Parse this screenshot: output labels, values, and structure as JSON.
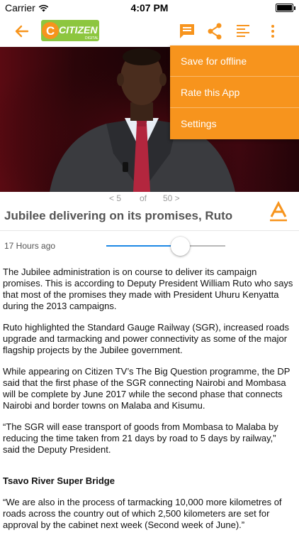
{
  "status_bar": {
    "carrier": "Carrier",
    "time": "4:07 PM",
    "battery_level": 1.0
  },
  "toolbar": {
    "logo_text": "CITIZEN",
    "logo_sub": "DIGITAL",
    "icons": [
      "back-arrow-icon",
      "comment-icon",
      "share-icon",
      "text-lines-icon",
      "more-vertical-icon"
    ]
  },
  "menu": {
    "items": [
      "Save for offline",
      "Rate this App",
      "Settings"
    ]
  },
  "pager": {
    "prev": "< 5",
    "of": "of",
    "next": "50 >"
  },
  "article": {
    "headline": "Jubilee delivering on its promises, Ruto",
    "time_ago": "17 Hours ago",
    "font_size_level": 0.62,
    "paragraphs": [
      "The Jubilee administration is on course to deliver its campaign promises. This is according to Deputy President William Ruto who says that most of the promises they made with President Uhuru Kenyatta during the 2013 campaigns.",
      "Ruto highlighted the Standard Gauge Railway (SGR), increased roads upgrade and tarmacking and power connectivity as some of the major flagship projects by the Jubilee government.",
      "While appearing on Citizen TV’s The Big Question programme, the DP said that the first phase of the SGR connecting Nairobi and Mombasa will be complete by June 2017 while the second phase that connects Nairobi and border towns on Malaba and Kisumu.",
      "“The SGR will ease transport of goods from Mombasa to Malaba by reducing the time taken from 21 days by road to 5 days by railway,” said the Deputy President."
    ],
    "subheading": "Tsavo River Super Bridge",
    "paragraph_after": "“We are also in the process of tarmacking 10,000 more kilometres of roads across the country out of which 2,500 kilometers are set for approval by the cabinet next week (Second week of June).”"
  },
  "colors": {
    "accent": "#f7941d",
    "slider_blue": "#1e88e5",
    "logo_green": "#8dc63f"
  }
}
